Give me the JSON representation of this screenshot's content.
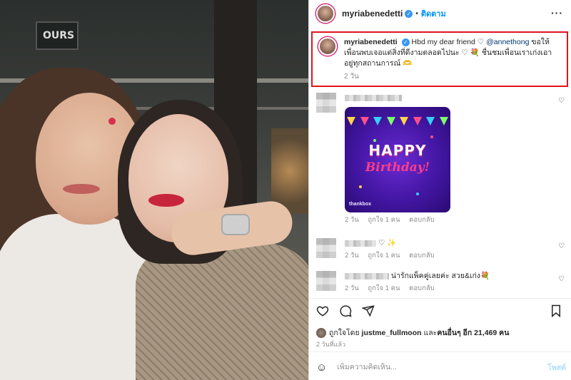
{
  "post_author": {
    "username": "myriabenedetti",
    "verified_icon": "verified-check-icon",
    "follow_label": "ติดตาม",
    "more_icon": "more-options-icon"
  },
  "caption": {
    "username": "myriabenedetti",
    "text_before": "Hbd my dear friend",
    "heart1": "♡",
    "mention": "@annethong",
    "text_after": "ขอให้เพื่อนพบเจอแต่สิ่งที่ดีงามตลอดไปนะ",
    "heart2": "♡",
    "bouquet": "💐",
    "text_end": "ชื่นชมเพื่อนเราเก่งเอาอยู่ทุกสถานการณ์",
    "hands": "🫶",
    "time": "2 วัน"
  },
  "comments": [
    {
      "image_text_happy": "HAPPY",
      "image_text_birthday": "Birthday!",
      "image_brand": "thankbox",
      "time": "2 วัน",
      "likes": "ถูกใจ 1 คน",
      "reply": "ตอบกลับ"
    },
    {
      "text": "♡ ✨",
      "time": "2 วัน",
      "likes": "ถูกใจ 1 คน",
      "reply": "ตอบกลับ"
    },
    {
      "text": "น่ารักแพ็คคู่เลยค่ะ สวย&เก่ง💐",
      "time": "2 วัน",
      "likes": "ถูกใจ 1 คน",
      "reply": "ตอบกลับ"
    }
  ],
  "actions": {
    "like_icon": "heart-icon",
    "comment_icon": "comment-icon",
    "share_icon": "share-icon",
    "save_icon": "bookmark-icon"
  },
  "likes": {
    "prefix": "ถูกใจโดย",
    "user": "justme_fullmoon",
    "middle": "และ",
    "others": "คนอื่นๆ อีก 21,469 คน"
  },
  "post_time": "2 วันที่แล้ว",
  "add_comment": {
    "placeholder": "เพิ่มความคิดเห็น...",
    "post_label": "โพสต์"
  },
  "colors": {
    "highlight_border": "#e0141e",
    "link": "#0095f6",
    "muted": "#8e8e8e"
  }
}
